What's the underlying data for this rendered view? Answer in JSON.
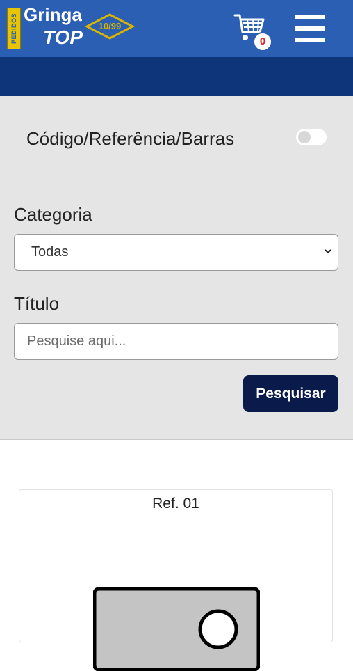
{
  "header": {
    "logo": {
      "side_text": "PEDIDOS",
      "line1": "Gringa",
      "line2": "TOP",
      "badge": "10/99"
    },
    "cart_count": "0",
    "cart_icon": "cart-icon",
    "menu_icon": "hamburger-menu-icon"
  },
  "search": {
    "code_label": "Código/Referência/Barras",
    "code_toggle_on": false,
    "category_label": "Categoria",
    "category_value": "Todas",
    "title_label": "Título",
    "title_placeholder": "Pesquise aqui...",
    "search_button": "Pesquisar"
  },
  "products": [
    {
      "ref": "Ref. 01",
      "image_icon": "image-placeholder-icon"
    }
  ],
  "colors": {
    "header": "#2b5fb3",
    "subbar": "#0e3479",
    "panel": "#e5e5e5",
    "button": "#0a1a4a",
    "logo_accent": "#e8c400",
    "cart_badge_text": "#e01b1b"
  }
}
